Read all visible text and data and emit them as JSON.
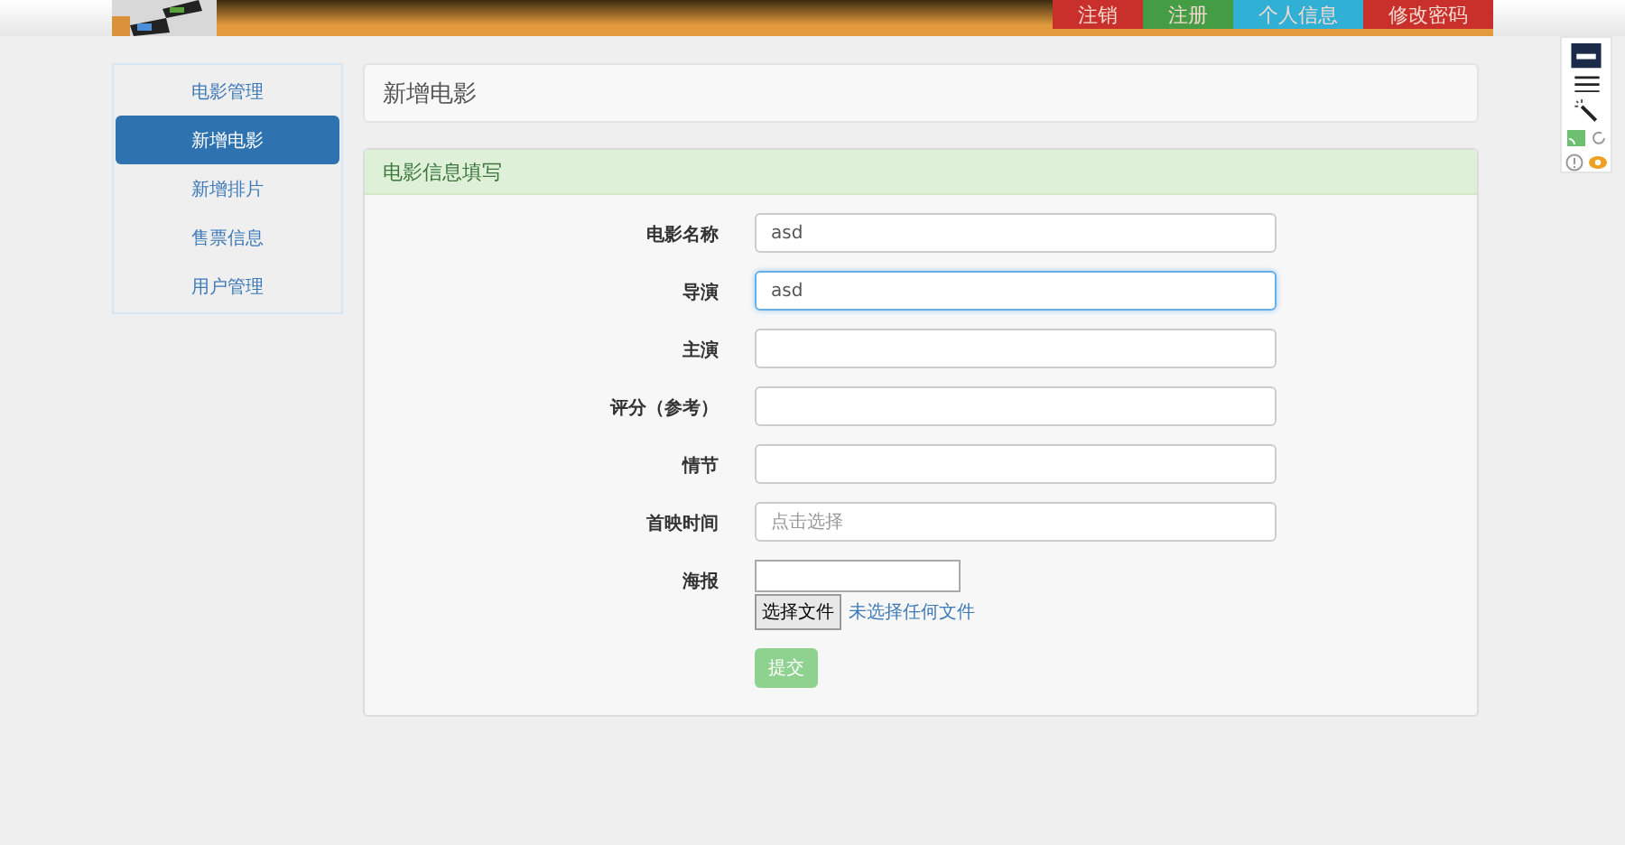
{
  "header": {
    "buttons": [
      {
        "label": "注销",
        "color": "#c9302c"
      },
      {
        "label": "注册",
        "color": "#449d44"
      },
      {
        "label": "个人信息",
        "color": "#31b0d5"
      },
      {
        "label": "修改密码",
        "color": "#c9302c"
      }
    ]
  },
  "sidebar": {
    "items": [
      {
        "label": "电影管理",
        "selected": false
      },
      {
        "label": "新增电影",
        "selected": true
      },
      {
        "label": "新增排片",
        "selected": false
      },
      {
        "label": "售票信息",
        "selected": false
      },
      {
        "label": "用户管理",
        "selected": false
      }
    ]
  },
  "page_title": "新增电影",
  "form": {
    "heading": "电影信息填写",
    "fields": [
      {
        "kind": "text",
        "label": "电影名称",
        "value": "asd",
        "focused": false
      },
      {
        "kind": "text",
        "label": "导演",
        "value": "asd",
        "focused": true
      },
      {
        "kind": "text",
        "label": "主演",
        "focused": false
      },
      {
        "kind": "text",
        "label": "评分（参考）",
        "focused": false
      },
      {
        "kind": "text",
        "label": "情节",
        "focused": false
      },
      {
        "kind": "text",
        "label": "首映时间",
        "placeholder": "点击选择",
        "focused": false
      },
      {
        "kind": "file",
        "label": "海报",
        "button": "选择文件",
        "status": "未选择任何文件"
      }
    ],
    "submit": "提交"
  }
}
